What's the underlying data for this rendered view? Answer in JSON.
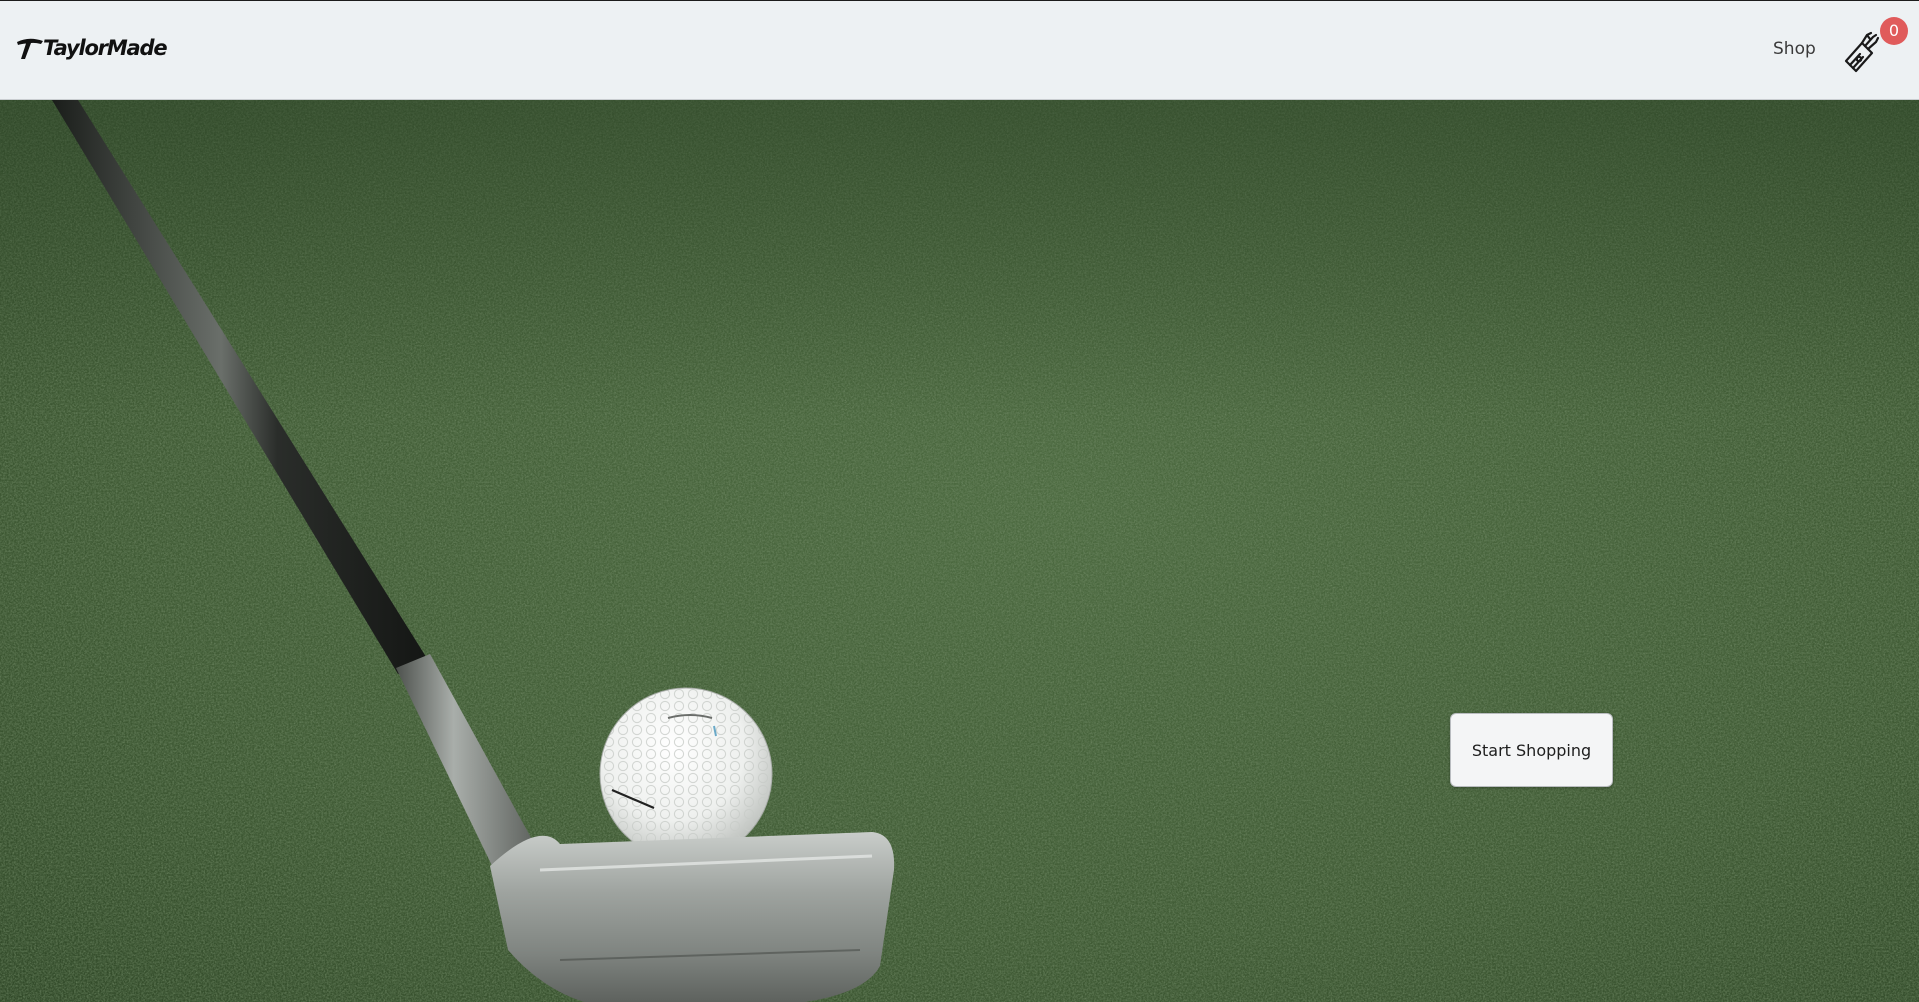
{
  "brand": {
    "logo_text": "TaylorMade",
    "logo_icon": "taylormade-t-logo"
  },
  "nav": {
    "shop_label": "Shop"
  },
  "cart": {
    "icon": "golf-bag-icon",
    "count": "0",
    "badge_color": "#e05b5b"
  },
  "hero": {
    "cta_label": "Start Shopping",
    "image": "golf-club-and-ball-on-grass"
  },
  "colors": {
    "header_bg": "#edf1f3",
    "grass": "#3f5a34",
    "button_bg": "#f4f5f6"
  }
}
